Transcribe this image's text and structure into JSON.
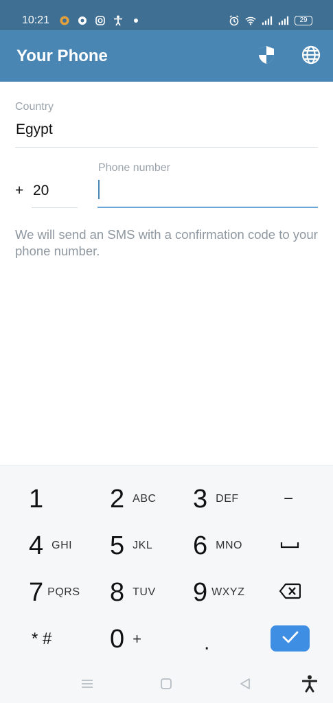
{
  "status_bar": {
    "time": "10:21",
    "battery_level": "29",
    "left_icons": [
      "notification-app-icon",
      "chrome-icon",
      "instagram-icon",
      "accessibility-icon",
      "dot-icon"
    ],
    "right_icons": [
      "alarm-icon",
      "wifi-icon",
      "signal-icon",
      "signal-icon"
    ]
  },
  "app_bar": {
    "title": "Your Phone",
    "actions": [
      "shield-icon",
      "globe-icon"
    ],
    "background_color": "#4a86b4"
  },
  "form": {
    "country_label": "Country",
    "country_value": "Egypt",
    "plus_sign": "+",
    "country_code": "20",
    "phone_label": "Phone number",
    "phone_value": "",
    "hint": "We will send an SMS with a confirmation code to your phone number."
  },
  "keypad": {
    "keys": [
      {
        "digit": "1",
        "letters": ""
      },
      {
        "digit": "2",
        "letters": "ABC"
      },
      {
        "digit": "3",
        "letters": "DEF"
      },
      {
        "digit": "−",
        "letters": ""
      },
      {
        "digit": "4",
        "letters": "GHI"
      },
      {
        "digit": "5",
        "letters": "JKL"
      },
      {
        "digit": "6",
        "letters": "MNO"
      },
      {
        "digit": "␣",
        "letters": ""
      },
      {
        "digit": "7",
        "letters": "PQRS"
      },
      {
        "digit": "8",
        "letters": "TUV"
      },
      {
        "digit": "9",
        "letters": "WXYZ"
      },
      {
        "digit": "⌫",
        "letters": ""
      },
      {
        "digit": "* #",
        "letters": ""
      },
      {
        "digit": "0",
        "letters": "+"
      },
      {
        "digit": ".",
        "letters": ""
      }
    ],
    "done_icon": "check-icon",
    "accent_color": "#3e8ee3"
  },
  "nav_bar": {
    "items": [
      "menu-icon",
      "home-icon",
      "back-icon",
      "accessibility-icon"
    ]
  }
}
